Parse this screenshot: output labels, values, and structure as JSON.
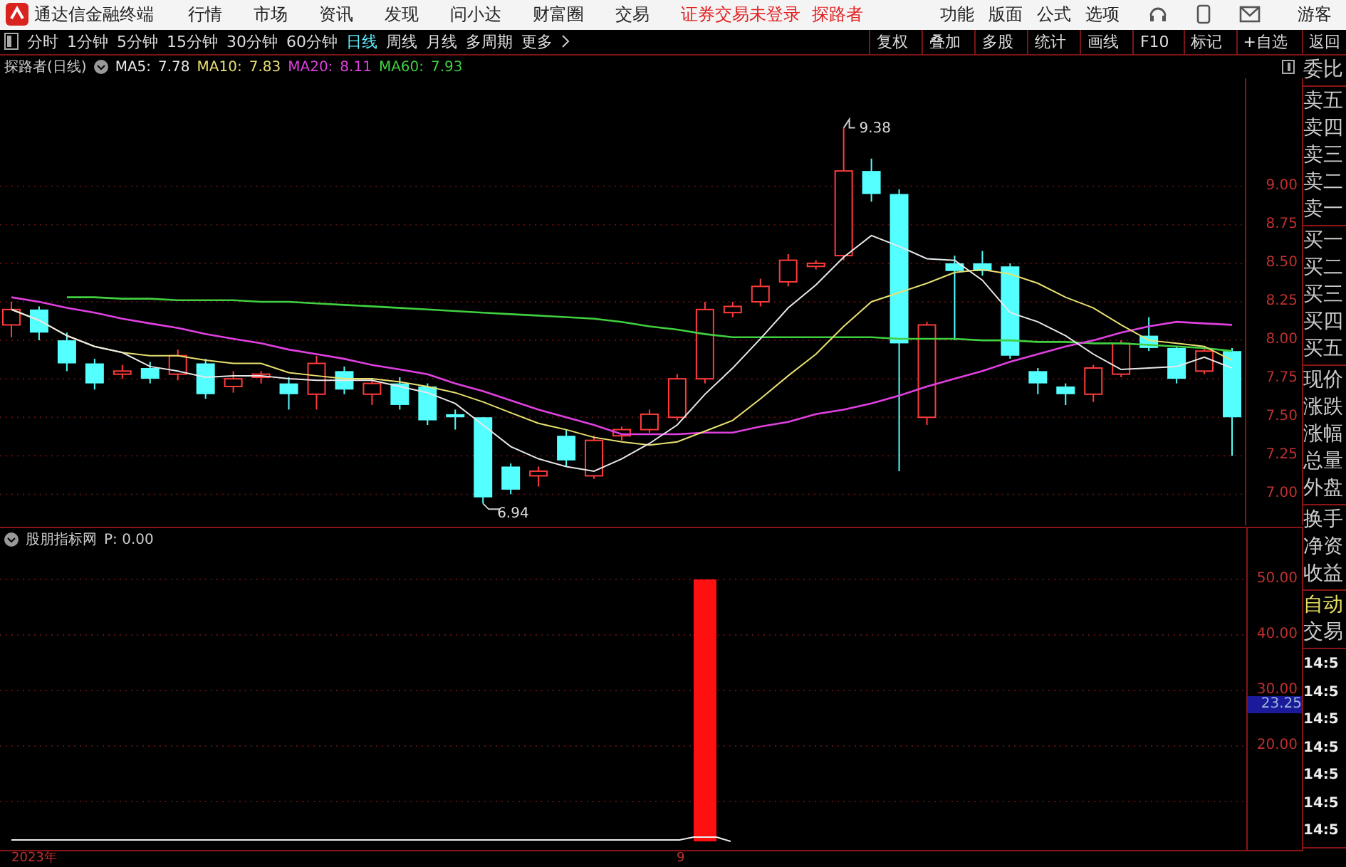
{
  "title_bar": {
    "app_name": "通达信金融终端",
    "menu": [
      "行情",
      "市场",
      "资讯",
      "发现",
      "问小达",
      "财富圈",
      "交易"
    ],
    "status_text": "证券交易未登录",
    "user_link": "探路者",
    "right_menu": [
      "功能",
      "版面",
      "公式",
      "选项"
    ],
    "guest": "游客"
  },
  "toolbar": {
    "periods": [
      {
        "label": "分时",
        "selected": false
      },
      {
        "label": "1分钟",
        "selected": false
      },
      {
        "label": "5分钟",
        "selected": false
      },
      {
        "label": "15分钟",
        "selected": false
      },
      {
        "label": "30分钟",
        "selected": false
      },
      {
        "label": "60分钟",
        "selected": false
      },
      {
        "label": "日线",
        "selected": true
      },
      {
        "label": "周线",
        "selected": false
      },
      {
        "label": "月线",
        "selected": false
      },
      {
        "label": "多周期",
        "selected": false
      }
    ],
    "more": "更多",
    "tools": [
      "复权",
      "叠加",
      "多股",
      "统计",
      "画线",
      "F10",
      "标记",
      "+自选",
      "返回"
    ]
  },
  "chart": {
    "title": "探路者(日线)",
    "ma": [
      {
        "value": "7.78"
      },
      {
        "value": "7.83"
      },
      {
        "value": "8.11"
      },
      {
        "value": "7.93"
      }
    ],
    "high_label": "9.38",
    "low_label": "6.94",
    "chart_data": {
      "type": "candlestick",
      "ylim": [
        6.8,
        9.7
      ],
      "grid": true,
      "yticks": [
        {
          "value": 9,
          "label": "9.00"
        },
        {
          "value": 8.75,
          "label": "8.75"
        },
        {
          "value": 8.5,
          "label": "8.50"
        },
        {
          "value": 8.25,
          "label": "8.25"
        },
        {
          "value": 8,
          "label": "8.00"
        },
        {
          "value": 7.75,
          "label": "7.75"
        },
        {
          "value": 7.5,
          "label": "7.50"
        },
        {
          "value": 7.25,
          "label": "7.25"
        },
        {
          "value": 7,
          "label": "7.00"
        }
      ],
      "ohlc": [
        [
          8.1,
          8.25,
          8.02,
          8.2
        ],
        [
          8.2,
          8.22,
          8.0,
          8.05
        ],
        [
          8.0,
          8.05,
          7.8,
          7.85
        ],
        [
          7.85,
          7.88,
          7.68,
          7.72
        ],
        [
          7.78,
          7.84,
          7.75,
          7.8
        ],
        [
          7.82,
          7.86,
          7.72,
          7.75
        ],
        [
          7.78,
          7.94,
          7.74,
          7.9
        ],
        [
          7.85,
          7.88,
          7.62,
          7.65
        ],
        [
          7.7,
          7.8,
          7.66,
          7.75
        ],
        [
          7.76,
          7.8,
          7.72,
          7.78
        ],
        [
          7.72,
          7.76,
          7.55,
          7.65
        ],
        [
          7.65,
          7.9,
          7.55,
          7.85
        ],
        [
          7.8,
          7.83,
          7.65,
          7.68
        ],
        [
          7.65,
          7.75,
          7.58,
          7.72
        ],
        [
          7.72,
          7.76,
          7.55,
          7.58
        ],
        [
          7.7,
          7.72,
          7.45,
          7.48
        ],
        [
          7.52,
          7.55,
          7.42,
          7.5
        ],
        [
          7.5,
          7.5,
          6.94,
          6.98
        ],
        [
          7.18,
          7.2,
          7.0,
          7.03
        ],
        [
          7.12,
          7.18,
          7.05,
          7.15
        ],
        [
          7.38,
          7.42,
          7.18,
          7.22
        ],
        [
          7.12,
          7.38,
          7.1,
          7.35
        ],
        [
          7.38,
          7.44,
          7.35,
          7.42
        ],
        [
          7.42,
          7.55,
          7.4,
          7.52
        ],
        [
          7.5,
          7.78,
          7.48,
          7.75
        ],
        [
          7.75,
          8.25,
          7.72,
          8.2
        ],
        [
          8.18,
          8.25,
          8.15,
          8.22
        ],
        [
          8.25,
          8.4,
          8.22,
          8.35
        ],
        [
          8.38,
          8.56,
          8.35,
          8.52
        ],
        [
          8.48,
          8.52,
          8.46,
          8.5
        ],
        [
          8.55,
          9.38,
          8.52,
          9.1
        ],
        [
          9.1,
          9.18,
          8.9,
          8.95
        ],
        [
          8.95,
          8.98,
          7.15,
          7.98
        ],
        [
          7.5,
          8.12,
          7.45,
          8.1
        ],
        [
          8.5,
          8.55,
          8.0,
          8.45
        ],
        [
          8.5,
          8.58,
          8.42,
          8.45
        ],
        [
          8.48,
          8.5,
          7.88,
          7.9
        ],
        [
          7.8,
          7.82,
          7.65,
          7.72
        ],
        [
          7.7,
          7.72,
          7.58,
          7.65
        ],
        [
          7.65,
          7.84,
          7.6,
          7.82
        ],
        [
          7.78,
          8.0,
          7.76,
          7.98
        ],
        [
          8.03,
          8.15,
          7.93,
          7.95
        ],
        [
          7.95,
          7.96,
          7.72,
          7.75
        ],
        [
          7.8,
          7.95,
          7.78,
          7.93
        ],
        [
          7.93,
          7.95,
          7.25,
          7.5
        ]
      ],
      "series": [
        {
          "name": "MA5:",
          "type": "line",
          "color": "#e8e8e8",
          "values": [
            8.2,
            8.13,
            8.03,
            7.96,
            7.92,
            7.83,
            7.8,
            7.76,
            7.77,
            7.77,
            7.75,
            7.74,
            7.74,
            7.74,
            7.7,
            7.66,
            7.59,
            7.45,
            7.31,
            7.23,
            7.18,
            7.15,
            7.23,
            7.33,
            7.45,
            7.65,
            7.82,
            8.01,
            8.21,
            8.36,
            8.54,
            8.68,
            8.61,
            8.53,
            8.52,
            8.39,
            8.18,
            8.12,
            8.03,
            7.91,
            7.81,
            7.82,
            7.83,
            7.89,
            7.82
          ]
        },
        {
          "name": "MA10:",
          "type": "line",
          "color": "#e8e070",
          "values": [
            8.2,
            8.13,
            8.03,
            7.96,
            7.92,
            7.9,
            7.9,
            7.87,
            7.85,
            7.85,
            7.79,
            7.77,
            7.75,
            7.75,
            7.73,
            7.7,
            7.66,
            7.6,
            7.53,
            7.46,
            7.42,
            7.37,
            7.34,
            7.32,
            7.34,
            7.41,
            7.48,
            7.62,
            7.77,
            7.91,
            8.09,
            8.25,
            8.31,
            8.37,
            8.44,
            8.46,
            8.43,
            8.37,
            8.28,
            8.21,
            8.1,
            8.0,
            7.98,
            7.96,
            7.87
          ]
        },
        {
          "name": "MA20:",
          "type": "line",
          "color": "#e040e0",
          "values": [
            8.28,
            8.25,
            8.21,
            8.18,
            8.14,
            8.11,
            8.08,
            8.04,
            8.01,
            7.98,
            7.94,
            7.91,
            7.88,
            7.84,
            7.81,
            7.78,
            7.72,
            7.67,
            7.61,
            7.55,
            7.5,
            7.45,
            7.39,
            7.39,
            7.39,
            7.4,
            7.4,
            7.44,
            7.47,
            7.52,
            7.55,
            7.59,
            7.64,
            7.7,
            7.75,
            7.8,
            7.86,
            7.91,
            7.96,
            8.0,
            8.05,
            8.09,
            8.12,
            8.11,
            8.1
          ]
        },
        {
          "name": "MA60:",
          "type": "line",
          "color": "#40d040",
          "values": [
            null,
            null,
            8.28,
            8.28,
            8.27,
            8.27,
            8.26,
            8.26,
            8.26,
            8.25,
            8.25,
            8.24,
            8.23,
            8.22,
            8.21,
            8.2,
            8.19,
            8.18,
            8.17,
            8.16,
            8.15,
            8.14,
            8.12,
            8.09,
            8.07,
            8.04,
            8.02,
            8.02,
            8.02,
            8.02,
            8.02,
            8.02,
            8.01,
            8.01,
            8.01,
            8.0,
            8.0,
            7.99,
            7.99,
            7.98,
            7.98,
            7.97,
            7.96,
            7.95,
            7.93
          ]
        }
      ]
    }
  },
  "indicator": {
    "title": "股朋指标网",
    "value": "P: 0.00",
    "ticks": [
      "50.00",
      "40.00",
      "30.00",
      "20.00"
    ],
    "current": "23.25"
  },
  "x_axis": [
    "2023年",
    "9"
  ],
  "quote_panel": {
    "groups": [
      [
        "委比"
      ],
      [
        "卖五",
        "卖四",
        "卖三",
        "卖二",
        "卖一"
      ],
      [
        "买一",
        "买二",
        "买三",
        "买四",
        "买五"
      ],
      [
        "现价",
        "涨跌",
        "涨幅",
        "总量",
        "外盘"
      ],
      [
        "换手",
        "净资",
        "收益"
      ],
      [
        "自动",
        "交易"
      ]
    ],
    "times": [
      "14:5",
      "14:5",
      "14:5",
      "14:5",
      "14:5",
      "14:5",
      "14:5"
    ]
  }
}
